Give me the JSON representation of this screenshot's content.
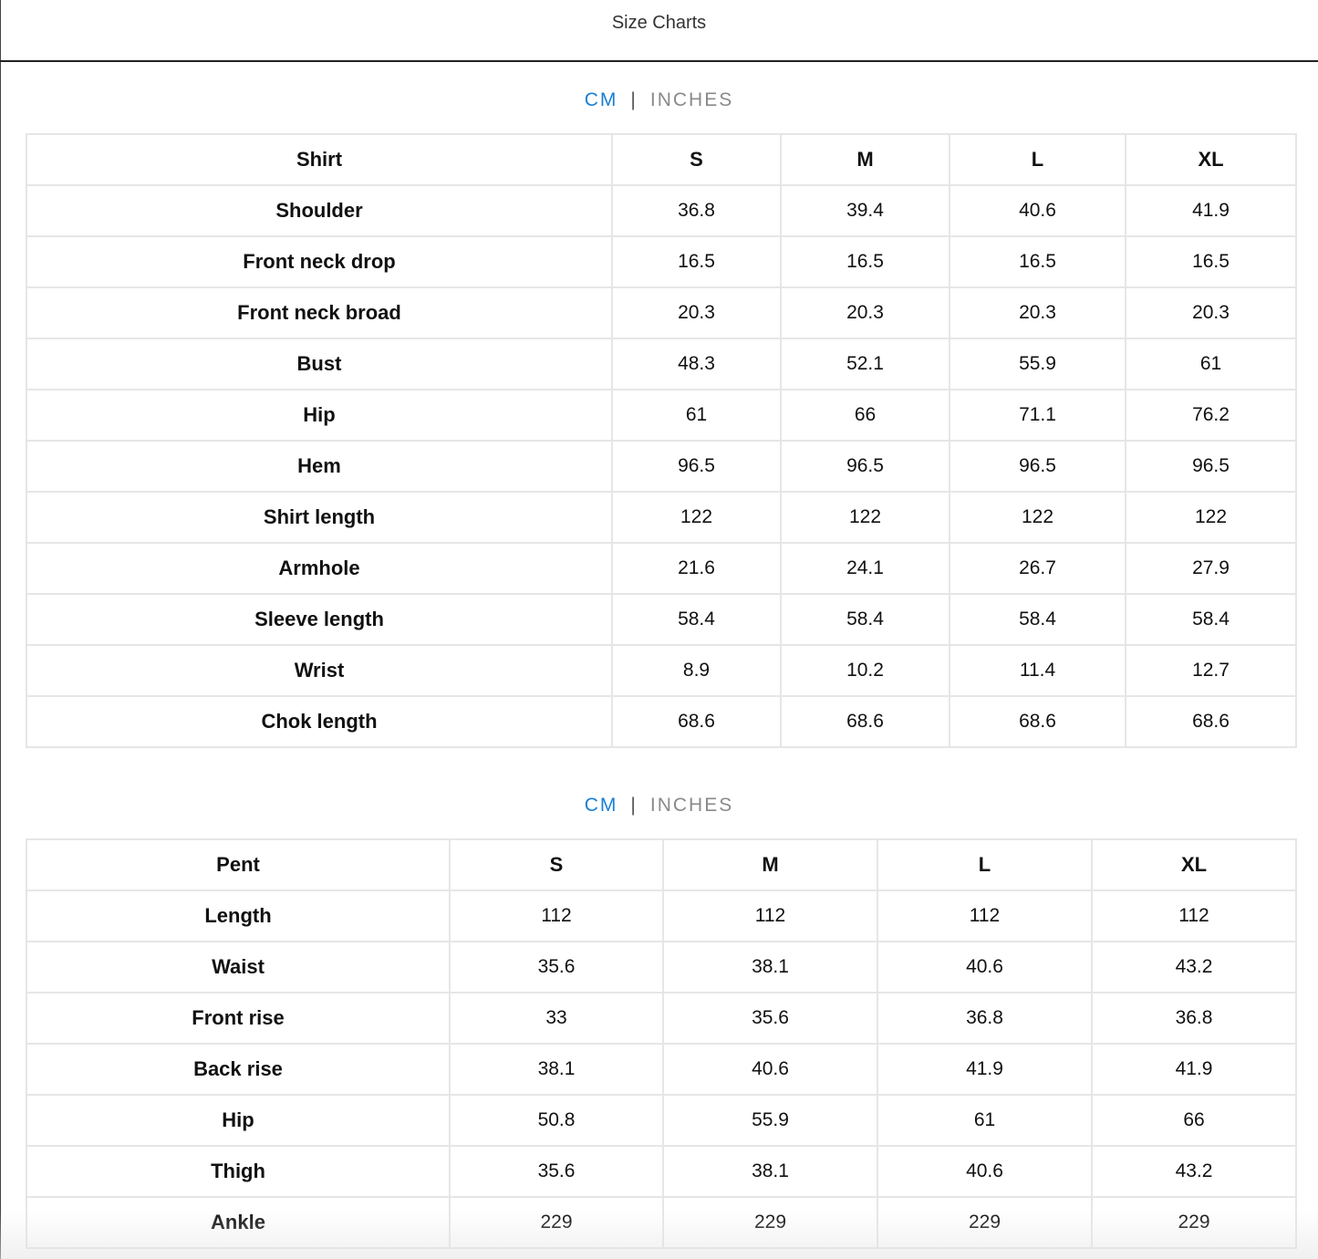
{
  "header": {
    "title": "Size Charts"
  },
  "unit_toggle": {
    "cm": "CM",
    "separator": "|",
    "inches": "INCHES",
    "active": "CM",
    "active_color": "#1a7fd4"
  },
  "shirt_table": {
    "columns": [
      "Shirt",
      "S",
      "M",
      "L",
      "XL"
    ],
    "rows": [
      [
        "Shoulder",
        "36.8",
        "39.4",
        "40.6",
        "41.9"
      ],
      [
        "Front neck drop",
        "16.5",
        "16.5",
        "16.5",
        "16.5"
      ],
      [
        "Front neck broad",
        "20.3",
        "20.3",
        "20.3",
        "20.3"
      ],
      [
        "Bust",
        "48.3",
        "52.1",
        "55.9",
        "61"
      ],
      [
        "Hip",
        "61",
        "66",
        "71.1",
        "76.2"
      ],
      [
        "Hem",
        "96.5",
        "96.5",
        "96.5",
        "96.5"
      ],
      [
        "Shirt length",
        "122",
        "122",
        "122",
        "122"
      ],
      [
        "Armhole",
        "21.6",
        "24.1",
        "26.7",
        "27.9"
      ],
      [
        "Sleeve length",
        "58.4",
        "58.4",
        "58.4",
        "58.4"
      ],
      [
        "Wrist",
        "8.9",
        "10.2",
        "11.4",
        "12.7"
      ],
      [
        "Chok length",
        "68.6",
        "68.6",
        "68.6",
        "68.6"
      ]
    ]
  },
  "pent_table": {
    "columns": [
      "Pent",
      "S",
      "M",
      "L",
      "XL"
    ],
    "rows": [
      [
        "Length",
        "112",
        "112",
        "112",
        "112"
      ],
      [
        "Waist",
        "35.6",
        "38.1",
        "40.6",
        "43.2"
      ],
      [
        "Front rise",
        "33",
        "35.6",
        "36.8",
        "36.8"
      ],
      [
        "Back rise",
        "38.1",
        "40.6",
        "41.9",
        "41.9"
      ],
      [
        "Hip",
        "50.8",
        "55.9",
        "61",
        "66"
      ],
      [
        "Thigh",
        "35.6",
        "38.1",
        "40.6",
        "43.2"
      ],
      [
        "Ankle",
        "229",
        "229",
        "229",
        "229"
      ]
    ]
  }
}
